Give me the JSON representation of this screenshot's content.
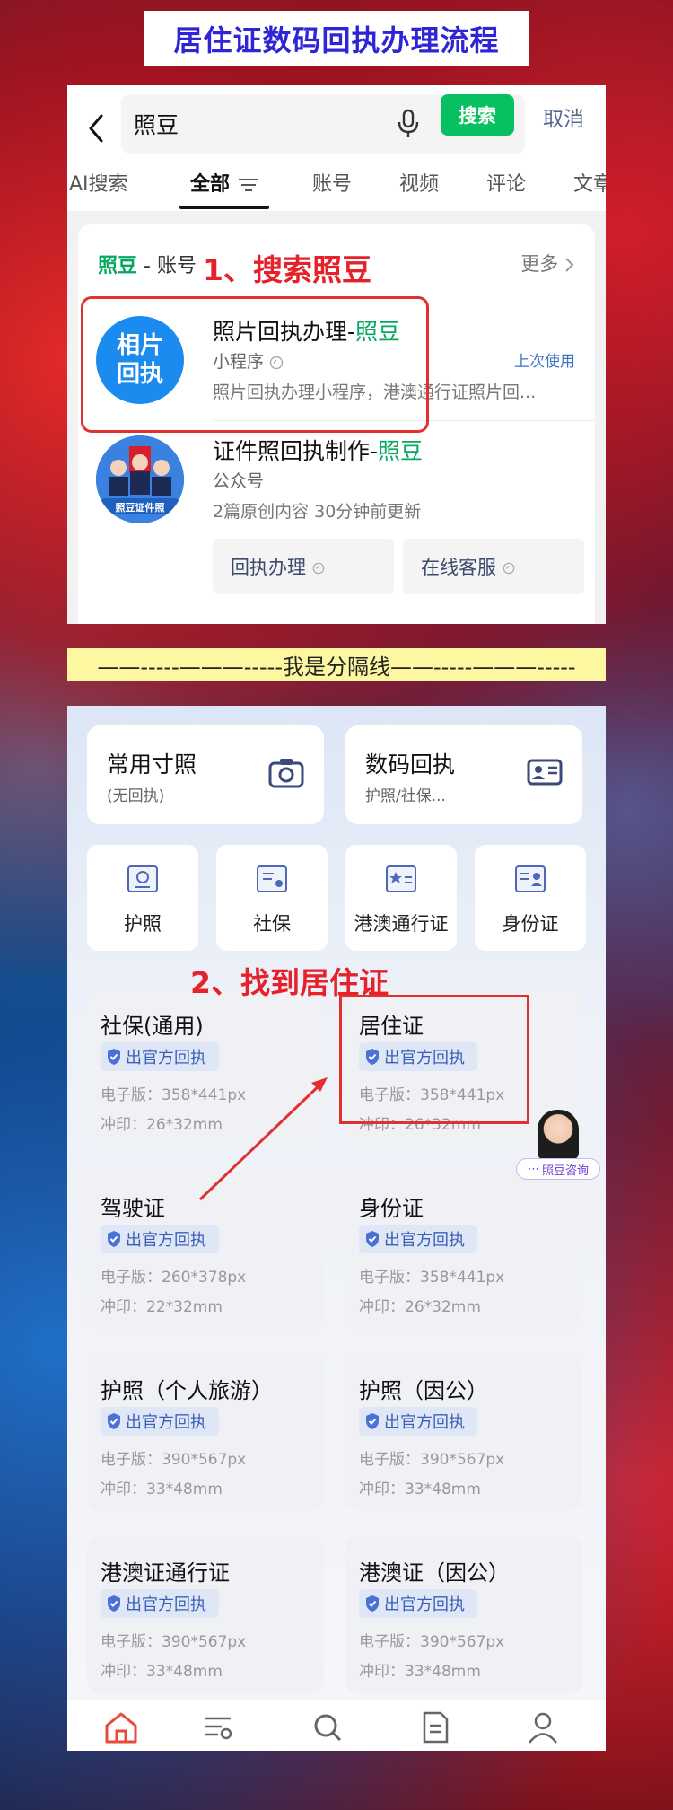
{
  "title": "居住证数码回执办理流程",
  "search_screen": {
    "query": "照豆",
    "search_button": "搜索",
    "cancel": "取消",
    "tabs": [
      "AI搜索",
      "全部",
      "账号",
      "视频",
      "评论",
      "文章"
    ],
    "active_tab": "全部",
    "section_title_highlight": "照豆",
    "section_title_rest": " - 账号",
    "more": "更多",
    "results": [
      {
        "avatar_text_1": "相片",
        "avatar_text_2": "回执",
        "title_main": "照片回执办理-",
        "title_highlight": "照豆",
        "type": "小程序",
        "badge": "上次使用",
        "desc": "照片回执办理小程序，港澳通行证照片回..."
      },
      {
        "avatar_caption": "照豆证件照",
        "title_main": "证件照回执制作-",
        "title_highlight": "照豆",
        "type": "公众号",
        "desc": "2篇原创内容  30分钟前更新",
        "buttons": [
          "回执办理",
          "在线客服"
        ]
      }
    ]
  },
  "step1": "1、搜索照豆",
  "separator": "——-----———-----我是分隔线——-----———-----",
  "app_screen": {
    "big_cards": [
      {
        "title": "常用寸照",
        "sub": "(无回执)",
        "icon": "camera-icon"
      },
      {
        "title": "数码回执",
        "sub": "护照/社保...",
        "icon": "id-card-icon"
      }
    ],
    "small_cards": [
      {
        "label": "护照",
        "icon": "passport-icon"
      },
      {
        "label": "社保",
        "icon": "social-security-icon"
      },
      {
        "label": "港澳通行证",
        "icon": "hk-macau-permit-icon"
      },
      {
        "label": "身份证",
        "icon": "id-icon"
      }
    ],
    "doc_cards": [
      {
        "title": "社保(通用)",
        "tag": "出官方回执",
        "digital": "电子版：358*441px",
        "print": "冲印：26*32mm"
      },
      {
        "title": "居住证",
        "tag": "出官方回执",
        "digital": "电子版：358*441px",
        "print": "冲印：26*32mm"
      },
      {
        "title": "驾驶证",
        "tag": "出官方回执",
        "digital": "电子版：260*378px",
        "print": "冲印：22*32mm"
      },
      {
        "title": "身份证",
        "tag": "出官方回执",
        "digital": "电子版：358*441px",
        "print": "冲印：26*32mm"
      },
      {
        "title": "护照（个人旅游）",
        "tag": "出官方回执",
        "digital": "电子版：390*567px",
        "print": "冲印：33*48mm"
      },
      {
        "title": "护照（因公）",
        "tag": "出官方回执",
        "digital": "电子版：390*567px",
        "print": "冲印：33*48mm"
      },
      {
        "title": "港澳证通行证",
        "tag": "出官方回执",
        "digital": "电子版：390*567px",
        "print": "冲印：33*48mm"
      },
      {
        "title": "港澳证（因公）",
        "tag": "出官方回执",
        "digital": "电子版：390*567px",
        "print": "冲印：33*48mm"
      }
    ],
    "consult_label": "照豆咨询",
    "nav": [
      {
        "icon": "home-icon",
        "active": true
      },
      {
        "icon": "category-icon",
        "active": false
      },
      {
        "icon": "search-icon",
        "active": false
      },
      {
        "icon": "document-icon",
        "active": false
      },
      {
        "icon": "profile-icon",
        "active": false
      }
    ]
  },
  "step2": "2、找到居住证",
  "colors": {
    "title_text": "#2f24d6",
    "wechat_green": "#07c160",
    "highlight_red": "#e6212a",
    "tag_blue": "#3b5fb6",
    "separator_bg": "#fcf7a0"
  }
}
